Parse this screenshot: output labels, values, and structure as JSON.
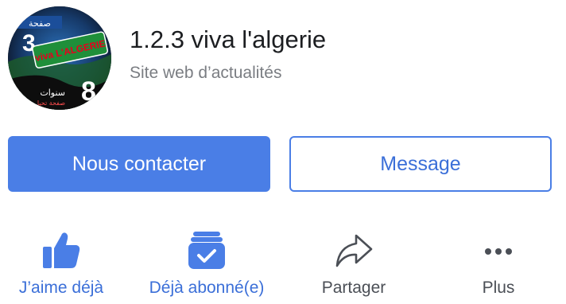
{
  "page": {
    "name": "1.2.3 viva l'algerie",
    "category": "Site web d’actualités",
    "avatar": {
      "brand_text": "viva L'ALGERIE",
      "top_text": "صفحة",
      "number": "3",
      "badge_number": "8",
      "arabic_caption": "سنوات",
      "arabic_sub": "صفحة تحيا"
    }
  },
  "buttons": {
    "contact_label": "Nous contacter",
    "message_label": "Message"
  },
  "actions": [
    {
      "label": "J’aime déjà",
      "icon": "thumbs-up-icon",
      "active": true
    },
    {
      "label": "Déjà abonné(e)",
      "icon": "followed-check-icon",
      "active": true
    },
    {
      "label": "Partager",
      "icon": "share-arrow-icon",
      "active": false
    },
    {
      "label": "Plus",
      "icon": "more-dots-icon",
      "active": false
    }
  ],
  "colors": {
    "accent": "#4a7ee6",
    "accent_text": "#3b6fd8",
    "muted_text": "#7a7d82",
    "icon_gray": "#4b4f56"
  }
}
